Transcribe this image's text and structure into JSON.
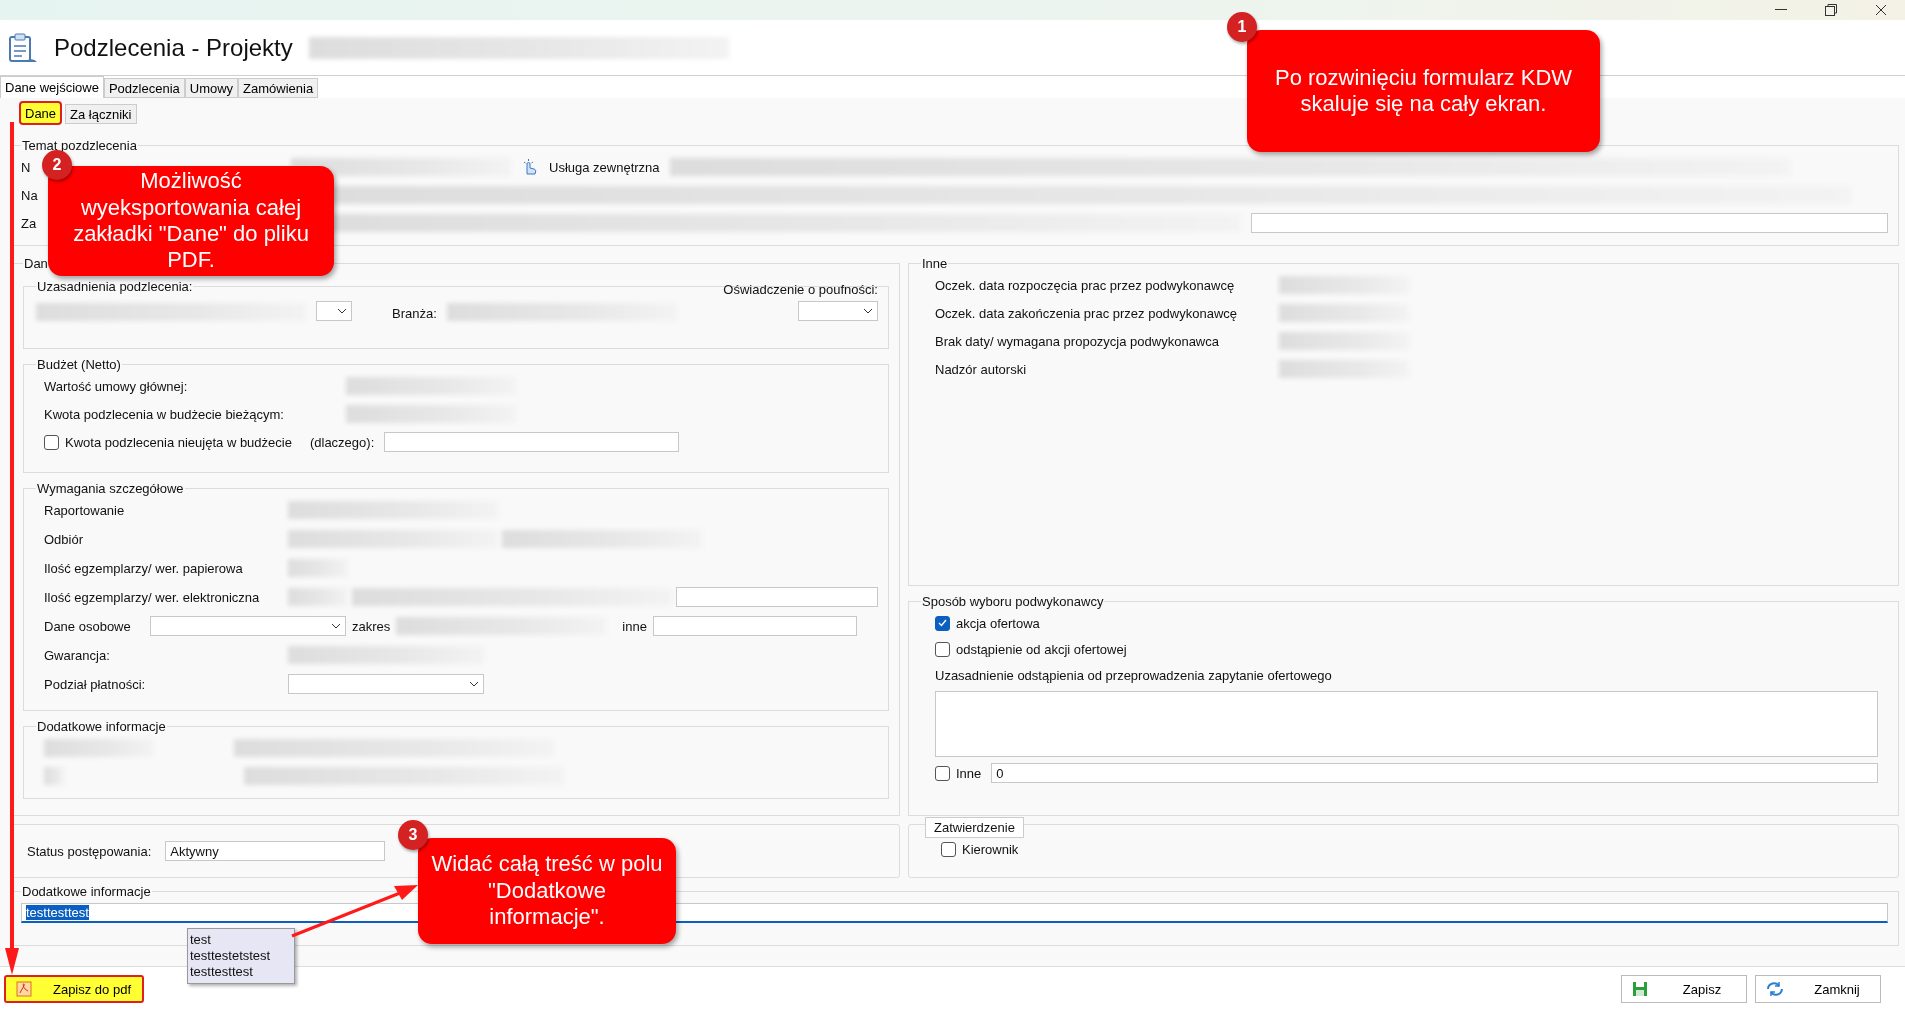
{
  "window": {
    "title": "Podzlecenia - Projekty"
  },
  "tabs": [
    {
      "label": "Dane wejściowe",
      "selected": true
    },
    {
      "label": "Podzlecenia",
      "selected": false
    },
    {
      "label": "Umowy",
      "selected": false
    },
    {
      "label": "Zamówienia",
      "selected": false
    }
  ],
  "subtabs": [
    {
      "label": "Dane",
      "selected": true,
      "highlighted": true
    },
    {
      "label": "Za łączniki",
      "selected": false,
      "highlighted": false
    }
  ],
  "temat": {
    "legend": "Temat pozdzlecenia",
    "labels": [
      "N",
      "Na",
      "Za"
    ],
    "service_label": "Usługa zewnętrzna"
  },
  "dane": {
    "legend": "Dan",
    "uzasadnienia": {
      "legend": "Uzasadnienia podzlecenia:",
      "branza_label": "Branża:",
      "poufnosc_label": "Oświadczenie o poufności:"
    },
    "budzet": {
      "legend": "Budżet (Netto)",
      "rows": [
        "Wartość umowy głównej:",
        "Kwota podzlecenia w budżecie bieżącym:"
      ],
      "checkbox": {
        "label": "Kwota podzlecenia nieujęta w budżecie",
        "checked": false
      },
      "reason_label": "(dlaczego):"
    },
    "wymagania": {
      "legend": "Wymagania szczegółowe",
      "rows": [
        "Raportowanie",
        "Odbiór",
        "Ilość egzemplarzy/ wer. papierowa",
        "Ilość egzemplarzy/ wer. elektroniczna"
      ],
      "personal_label": "Dane osobowe",
      "scope_label": "zakres",
      "other_label": "inne",
      "warranty_label": "Gwarancja:",
      "payment_label": "Podział płatności:"
    },
    "dodatkowe": {
      "legend": "Dodatkowe informacje"
    }
  },
  "inne": {
    "legend": "Inne",
    "rows": [
      "Oczek. data rozpoczęcia prac przez podwykonawcę",
      "Oczek. data zakończenia prac przez podwykonawcę",
      "Brak daty/ wymagana propozycja podwykonawca",
      "Nadzór autorski"
    ]
  },
  "sposob": {
    "legend": "Sposób wyboru podwykonawcy",
    "options": [
      {
        "label": "akcja ofertowa",
        "checked": true
      },
      {
        "label": "odstąpienie od akcji ofertowej",
        "checked": false
      }
    ],
    "justification_label": "Uzasadnienie odstąpienia od przeprowadzenia zapytanie ofertowego",
    "other": {
      "label": "Inne",
      "checked": false,
      "value": "0"
    }
  },
  "status": {
    "label": "Status postępowania:",
    "value": "Aktywny"
  },
  "zatwierdzenie": {
    "legend": "Zatwierdzenie",
    "checkbox": {
      "label": "Kierownik",
      "checked": false
    }
  },
  "notes": {
    "legend": "Dodatkowe informacje",
    "value": "testtesttest",
    "suggestions": [
      "test",
      "testtestetstest",
      "testtesttest"
    ]
  },
  "footer": {
    "buttons": [
      {
        "label": "Zapisz do pdf",
        "kind": "pdf",
        "highlighted": true
      },
      {
        "label": "Zapisz",
        "kind": "save",
        "highlighted": false
      },
      {
        "label": "Zamknij",
        "kind": "close",
        "highlighted": false
      }
    ]
  },
  "callouts": [
    {
      "number": "1",
      "text": "Po rozwinięciu formularz KDW skaluje się na cały ekran."
    },
    {
      "number": "2",
      "text": "Możliwość wyeksportowania całej zakładki \"Dane\" do pliku PDF."
    },
    {
      "number": "3",
      "text": "Widać całą treść w polu \"Dodatkowe informacje\"."
    }
  ]
}
